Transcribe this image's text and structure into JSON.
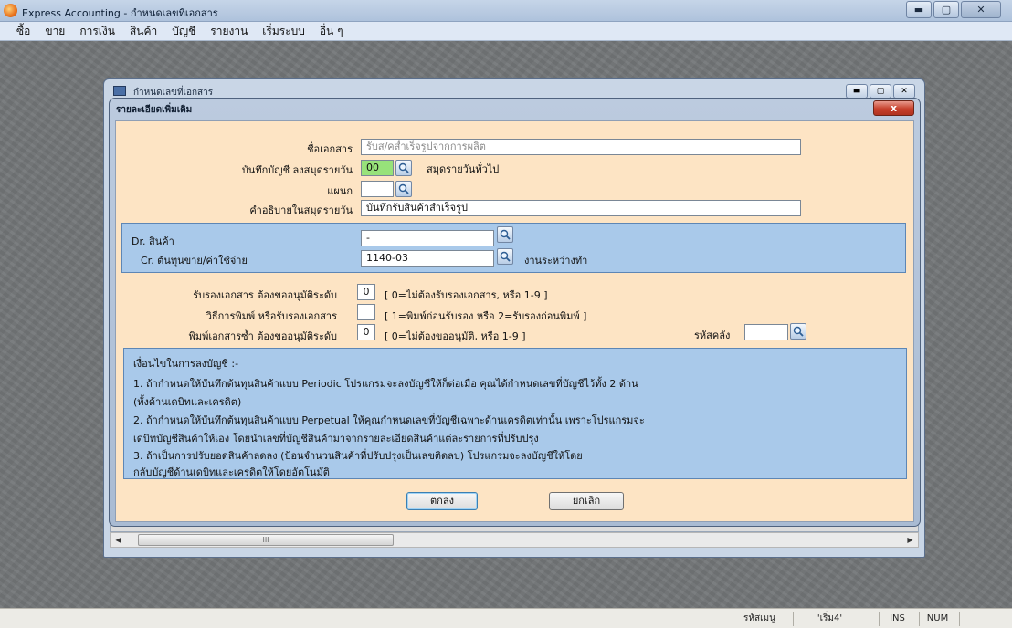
{
  "app": {
    "title": "Express Accounting - กำหนดเลขที่เอกสาร",
    "controls": {
      "minimize": "▬",
      "maximize": "▢",
      "close": "✕"
    }
  },
  "menu": [
    "ซื้อ",
    "ขาย",
    "การเงิน",
    "สินค้า",
    "บัญชี",
    "รายงาน",
    "เริ่มระบบ",
    "อื่น ๆ"
  ],
  "child_window": {
    "title": "กำหนดเลขที่เอกสาร",
    "scroll_thumb": "III"
  },
  "dialog": {
    "title": "รายละเอียดเพิ่มเติม",
    "close": "x",
    "fields": {
      "doc_name": {
        "label": "ชื่อเอกสาร",
        "value": "รับส/คส่ำเร็จรูปจากการผลิต"
      },
      "journal": {
        "label": "บันทึกบัญชี ลงสมุดรายวัน",
        "code": "00",
        "desc": "สมุดรายวันทั่วไป"
      },
      "department": {
        "label": "แผนก",
        "value": ""
      },
      "journal_desc": {
        "label": "คำอธิบายในสมุดรายวัน",
        "value": "บันทึกรับสินค้าสำเร็จรูป"
      }
    },
    "accounts": {
      "dr": {
        "label": "Dr. สินค้า",
        "value": "-"
      },
      "cr": {
        "label": "Cr. ต้นทุนขาย/ค่าใช้จ่าย",
        "value": "1140-03",
        "desc": "งานระหว่างทำ"
      }
    },
    "options": {
      "approve": {
        "label": "รับรองเอกสาร ต้องขออนุมัติระดับ",
        "value": "0",
        "hint": "[ 0=ไม่ต้องรับรองเอกสาร,  หรือ 1-9 ]"
      },
      "print_method": {
        "label": "วิธีการพิมพ์ หรือรับรองเอกสาร",
        "value": "",
        "hint": "[ 1=พิมพ์ก่อนรับรอง  หรือ 2=รับรองก่อนพิมพ์ ]"
      },
      "reprint": {
        "label": "พิมพ์เอกสารซ้ำ ต้องขออนุมัติระดับ",
        "value": "0",
        "hint": "[ 0=ไม่ต้องขออนุมัติ,  หรือ 1-9 ]"
      },
      "warehouse": {
        "label": "รหัสคลัง",
        "value": ""
      }
    },
    "conditions": {
      "heading": "เงื่อนไขในการลงบัญชี :-",
      "lines": [
        "1. ถ้ากำหนดให้บันทึกต้นทุนสินค้าแบบ Periodic  โปรแกรมจะลงบัญชีให้ก็ต่อเมื่อ คุณได้กำหนดเลขที่บัญชีไว้ทั้ง 2 ด้าน",
        "    (ทั้งด้านเดบิทและเครดิต)",
        "2. ถ้ากำหนดให้บันทึกต้นทุนสินค้าแบบ Perpetual  ให้คุณกำหนดเลขที่บัญชีเฉพาะด้านเครดิตเท่านั้น  เพราะโปรแกรมจะ",
        "    เดบิทบัญชีสินค้าให้เอง  โดยนำเลขที่บัญชีสินค้ามาจากรายละเอียดสินค้าแต่ละรายการที่ปรับปรุง",
        "3. ถ้าเป็นการปรับยอดสินค้าลดลง  (ป้อนจำนวนสินค้าที่ปรับปรุงเป็นเลขติดลบ)  โปรแกรมจะลงบัญชีให้โดย",
        "    กลับบัญชีด้านเดบิทและเครดิตให้โดยอัตโนมัติ"
      ]
    },
    "buttons": {
      "ok": "ตกลง",
      "cancel": "ยกเลิก"
    }
  },
  "status_bar": {
    "menu_code_label": "รหัสเมนู",
    "menu_code": "'เริ่ม4'",
    "ins": "INS",
    "num": "NUM"
  },
  "colors": {
    "dialog_body": "#fde4c4",
    "panel_blue": "#a9c9ea",
    "code_green": "#97e27a",
    "close_red": "#c7412c"
  }
}
